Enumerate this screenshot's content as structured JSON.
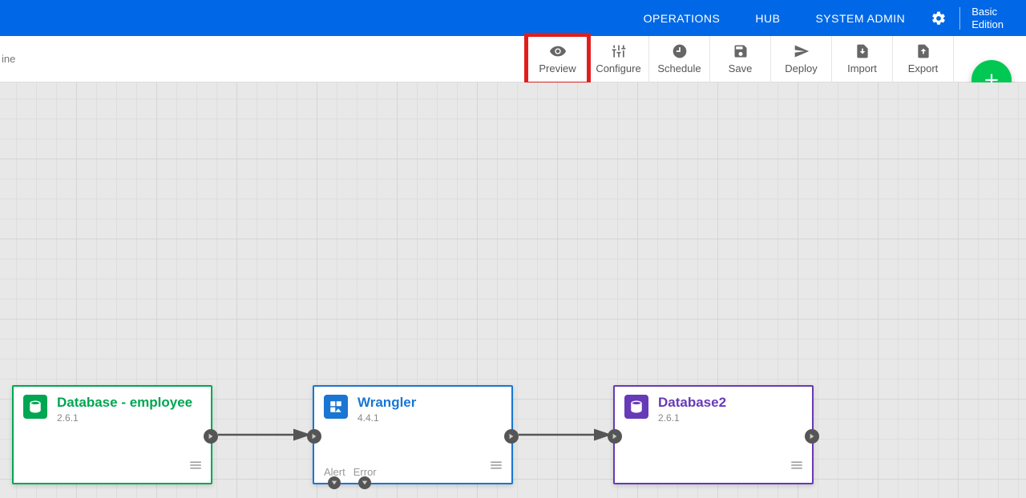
{
  "header": {
    "nav": [
      "OPERATIONS",
      "HUB",
      "SYSTEM ADMIN"
    ],
    "edition_line1": "Basic",
    "edition_line2": "Edition"
  },
  "toolbar": {
    "left_partial": "ine",
    "buttons": {
      "preview": "Preview",
      "configure": "Configure",
      "schedule": "Schedule",
      "save": "Save",
      "deploy": "Deploy",
      "import": "Import",
      "export": "Export"
    }
  },
  "nodes": {
    "source": {
      "title": "Database - employee",
      "version": "2.6.1"
    },
    "transform": {
      "title": "Wrangler",
      "version": "4.4.1",
      "portA": "Alert",
      "portB": "Error"
    },
    "sink": {
      "title": "Database2",
      "version": "2.6.1"
    }
  }
}
